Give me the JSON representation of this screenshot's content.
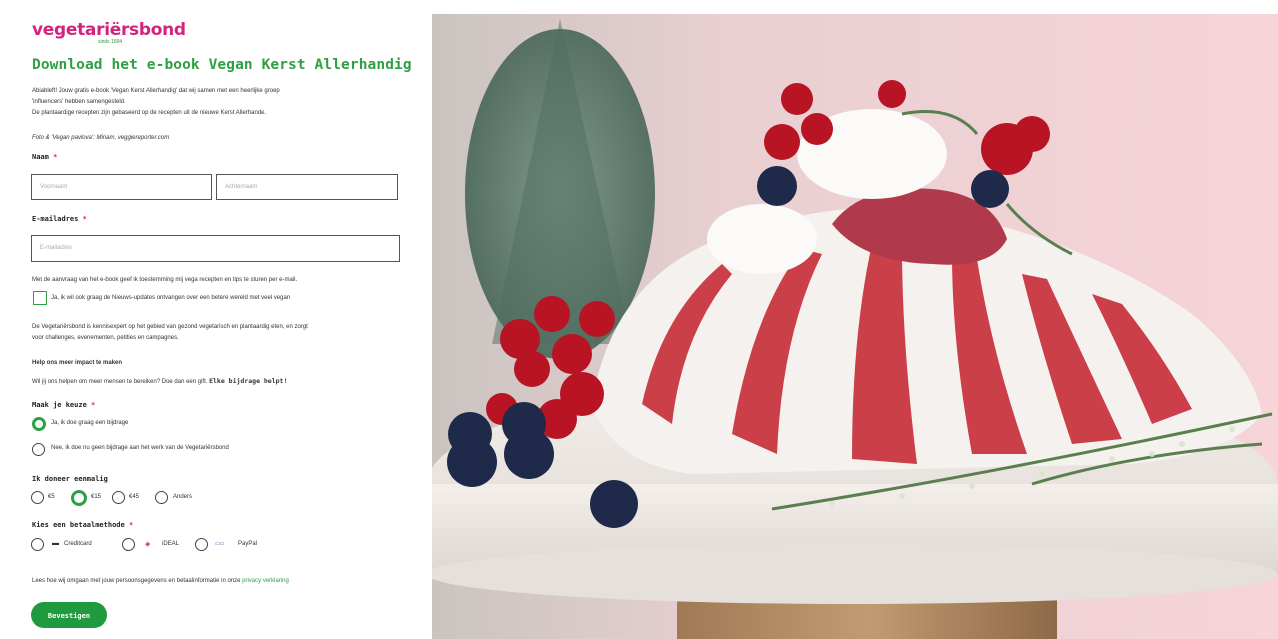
{
  "brand": {
    "name": "vegetariërsbond",
    "tagline": "sinds 1894"
  },
  "form": {
    "title": "Download het e-book Vegan Kerst Allerhandig",
    "intro_line1": "Abiableft! Jouw gratis e-book 'Vegan Kerst Allerhandig' dat wij samen met een heerlijke groep",
    "intro_line2": "'influencers' hebben samengesteld.",
    "intro_line3": "De plantaardige recepten zijn gebaseerd op de recepten uit de nieuwe Kerst Allerhande.",
    "photo_credit": "Foto & 'Vegan pavlova': Miriam, veggiereporter.com",
    "name_label": "Naam",
    "required_mark": "*",
    "first_name_placeholder": "Voornaam",
    "last_name_placeholder": "Achternaam",
    "email_label": "E-mailadres",
    "email_placeholder": "E-mailadres",
    "consent_text": "Met de aanvraag van het e-book geef ik toestemming mij vega recepten en tips te sturen per e-mail.",
    "newsletter_label": "Ja, ik wil ook graag de Nieuws-updates ontvangen over een betere wereld met veel vegan",
    "about_line1": "De Vegetariërsbond is kennisexpert op het gebied van gezond vegetarisch en plantaardig eten, en zorgt",
    "about_line2": "voor challenges, evenementen, petities en campagnes.",
    "impact_heading": "Help ons meer impact te maken",
    "impact_text": "Wil jij ons helpen om meer mensen te bereiken? Doe dan een gift.",
    "impact_bold": "Elke bijdrage helpt!",
    "choice_label": "Maak je keuze",
    "choice_yes": "Ja, ik doe graag een bijdrage",
    "choice_no": "Nee, ik doe nu geen bijdrage aan het werk van de Vegetariërsbond",
    "donate_label": "Ik doneer eenmalig",
    "amounts": [
      "€5",
      "€15",
      "€45",
      "Anders"
    ],
    "payment_label": "Kies een betaalmethode",
    "payment_methods": [
      "Creditcard",
      "iDEAL",
      "PayPal"
    ],
    "privacy_text": "Lees hoe wij omgaan met jouw persoonsgegevens en betaalinformatie in onze",
    "privacy_link": "privacy verklaring",
    "submit_label": "Bevestigen"
  },
  "colors": {
    "brand_pink": "#d4237a",
    "brand_green": "#2ea043",
    "button_green": "#1f9a3f"
  }
}
